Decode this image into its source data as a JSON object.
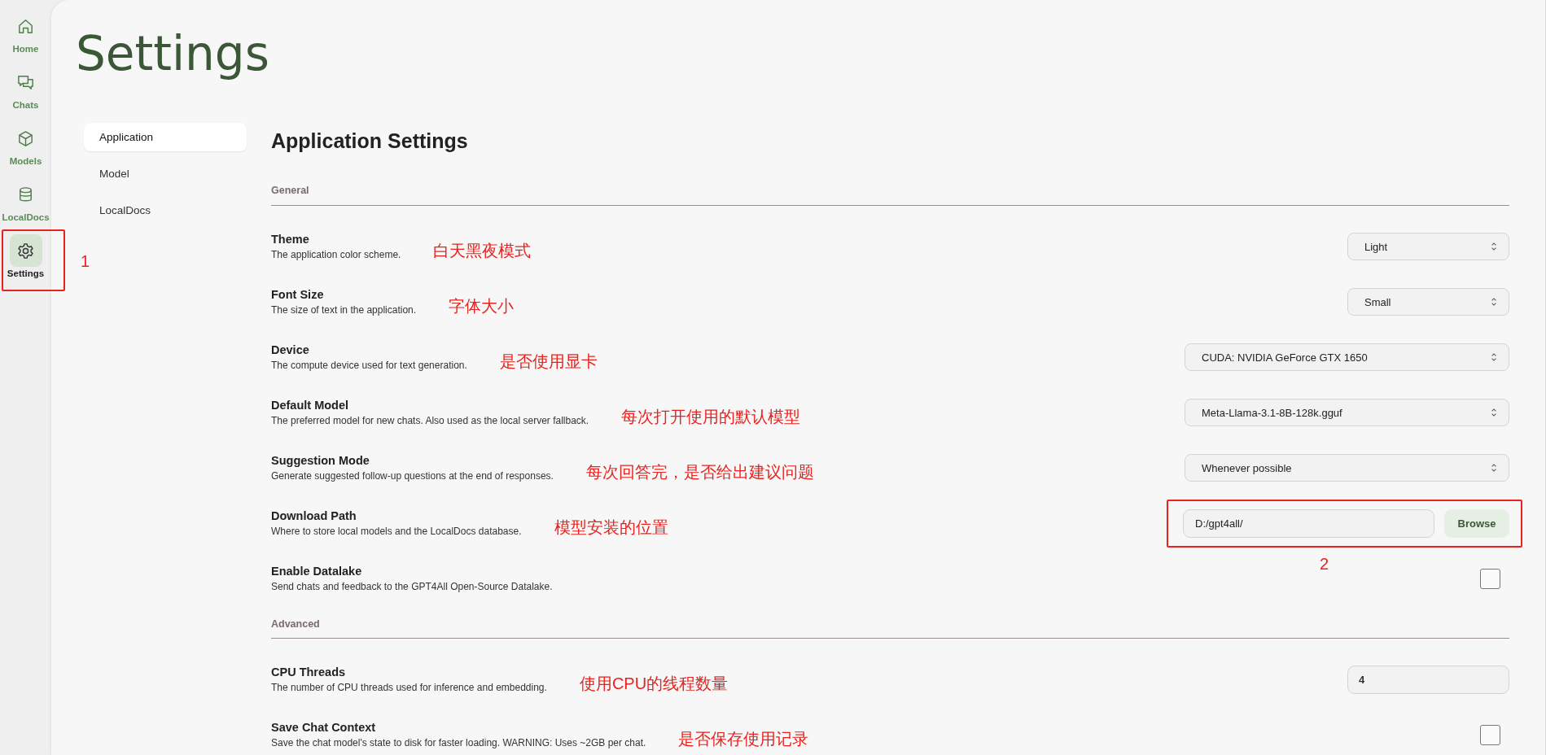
{
  "sidebar": {
    "items": [
      {
        "label": "Home",
        "selected": false
      },
      {
        "label": "Chats",
        "selected": false
      },
      {
        "label": "Models",
        "selected": false
      },
      {
        "label": "LocalDocs",
        "selected": false
      },
      {
        "label": "Settings",
        "selected": true,
        "callout": "1"
      }
    ]
  },
  "title": "Settings",
  "settings_nav": {
    "items": [
      {
        "label": "Application",
        "selected": true
      },
      {
        "label": "Model",
        "selected": false
      },
      {
        "label": "LocalDocs",
        "selected": false
      }
    ]
  },
  "heading": "Application Settings",
  "sections": [
    {
      "title": "General",
      "rows": [
        {
          "kind": "select",
          "title": "Theme",
          "description": "The application color scheme.",
          "note": "白天黑夜模式",
          "value": "Light"
        },
        {
          "kind": "select",
          "title": "Font Size",
          "description": "The size of text in the application.",
          "note": "字体大小",
          "value": "Small"
        },
        {
          "kind": "select",
          "title": "Device",
          "description": "The compute device used for text generation.",
          "note": "是否使用显卡",
          "value": "CUDA: NVIDIA GeForce GTX 1650"
        },
        {
          "kind": "select",
          "title": "Default Model",
          "description": "The preferred model for new chats. Also used as the local server fallback.",
          "note": "每次打开使用的默认模型",
          "value": "Meta-Llama-3.1-8B-128k.gguf"
        },
        {
          "kind": "select",
          "title": "Suggestion Mode",
          "description": "Generate suggested follow-up questions at the end of responses.",
          "note": "每次回答完，是否给出建议问题",
          "value": "Whenever possible"
        },
        {
          "kind": "path",
          "title": "Download Path",
          "description": "Where to store local models and the LocalDocs database.",
          "note": "模型安装的位置",
          "value": "D:/gpt4all/",
          "button": "Browse",
          "callout": "2"
        },
        {
          "kind": "checkbox",
          "title": "Enable Datalake",
          "description": "Send chats and feedback to the GPT4All Open-Source Datalake.",
          "checked": false
        }
      ]
    },
    {
      "title": "Advanced",
      "rows": [
        {
          "kind": "number",
          "title": "CPU Threads",
          "description": "The number of CPU threads used for inference and embedding.",
          "note": "使用CPU的线程数量",
          "value": "4"
        },
        {
          "kind": "checkbox",
          "title": "Save Chat Context",
          "description": "Save the chat model's state to disk for faster loading. WARNING: Uses ~2GB per chat.",
          "note": "是否保存使用记录",
          "checked": false
        }
      ]
    }
  ]
}
